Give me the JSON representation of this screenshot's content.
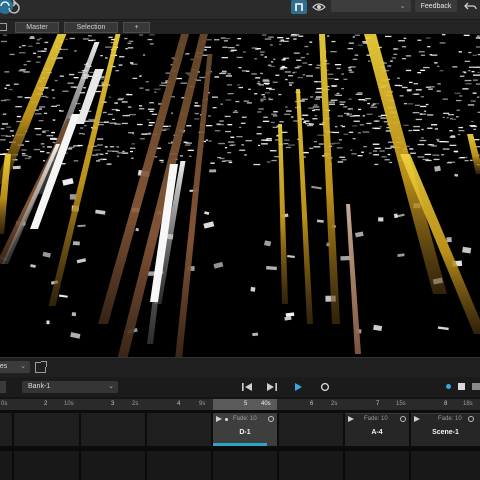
{
  "topbar": {
    "output_select": "",
    "feedback_label": "Feedback"
  },
  "tabs": [
    {
      "label": "Master"
    },
    {
      "label": "Selection"
    },
    {
      "label": "+"
    }
  ],
  "transport": {
    "cues_select": "ues",
    "bank_select": "Bank-1"
  },
  "cue_header": [
    {
      "num": "",
      "time": "0s"
    },
    {
      "num": "2",
      "time": "10s"
    },
    {
      "num": "3",
      "time": "2s"
    },
    {
      "num": "4",
      "time": "9s"
    },
    {
      "num": "5",
      "time": "40s"
    },
    {
      "num": "6",
      "time": "2s"
    },
    {
      "num": "7",
      "time": "15s"
    },
    {
      "num": "8",
      "time": "18s"
    }
  ],
  "cues": [
    {
      "fade": "Fade: 10",
      "name": "D-1"
    },
    {
      "fade": "Fade: 10",
      "name": "A-4"
    },
    {
      "fade": "Fade: 10",
      "name": "Scene-1"
    }
  ],
  "cue_progress": 0.85,
  "colors": {
    "accent": "#2aa6c7",
    "play": "#39a6e8",
    "beam_gold": "#e8c52a",
    "beam_brown": "#7a5530"
  },
  "icons": [
    "sync-icon",
    "refresh-icon",
    "app-logo-icon",
    "eye-icon",
    "undo-icon",
    "panel-toggle-icon",
    "popout-icon",
    "skip-back-icon",
    "skip-forward-icon",
    "play-icon",
    "record-icon",
    "stop-icon",
    "grid-icon"
  ]
}
